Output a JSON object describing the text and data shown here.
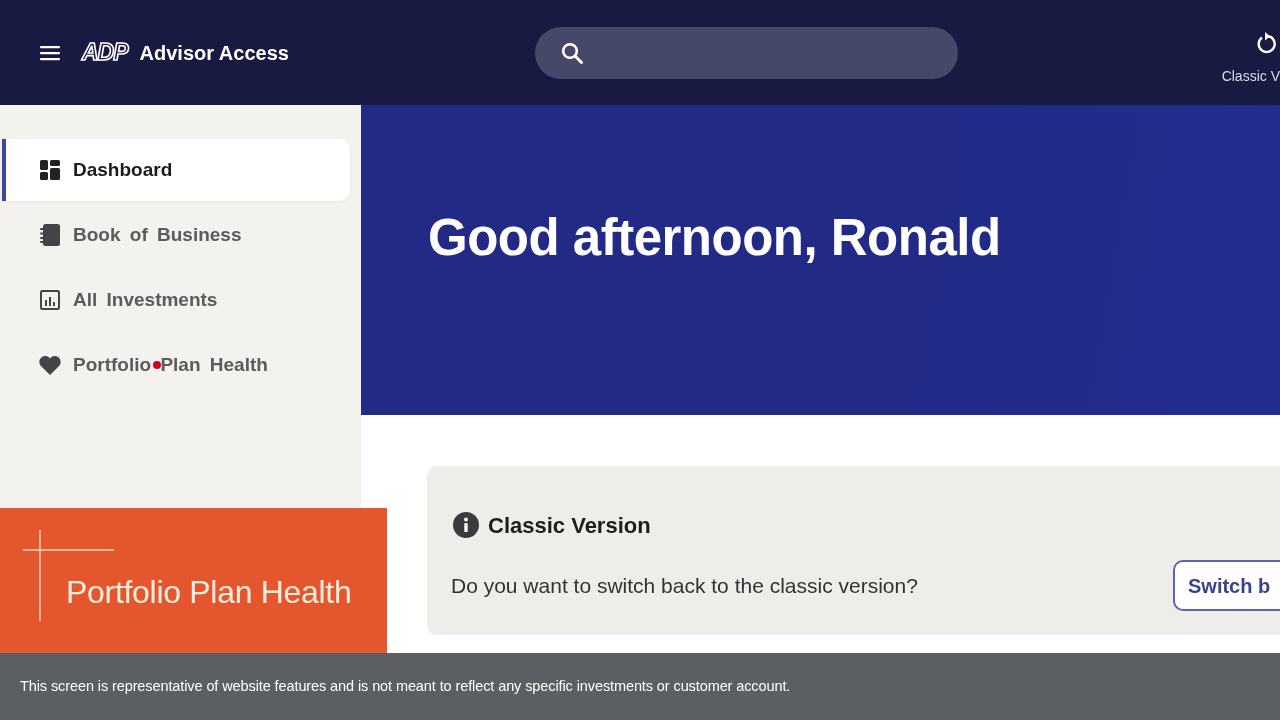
{
  "header": {
    "logo": "ADP",
    "app_name": "Advisor Access",
    "classic_view_label": "Classic V"
  },
  "sidebar": {
    "items": [
      {
        "label": "Dashboard",
        "kind": "dashboard",
        "selected": true
      },
      {
        "label": "Book of Business",
        "kind": "book",
        "selected": false
      },
      {
        "label": "All Investments",
        "kind": "chart",
        "selected": false
      },
      {
        "label": "Portfolio Plan Health",
        "kind": "heart",
        "selected": false
      }
    ]
  },
  "hero": {
    "greeting": "Good afternoon, Ronald"
  },
  "notice_card": {
    "title": "Classic Version",
    "message": "Do you want to switch back to the classic version?",
    "button": "Switch b"
  },
  "video_overlay": {
    "title": "Portfolio Plan Health"
  },
  "disclaimer": "This screen is representative of website features and is not meant to reflect any specific investments or customer account."
}
